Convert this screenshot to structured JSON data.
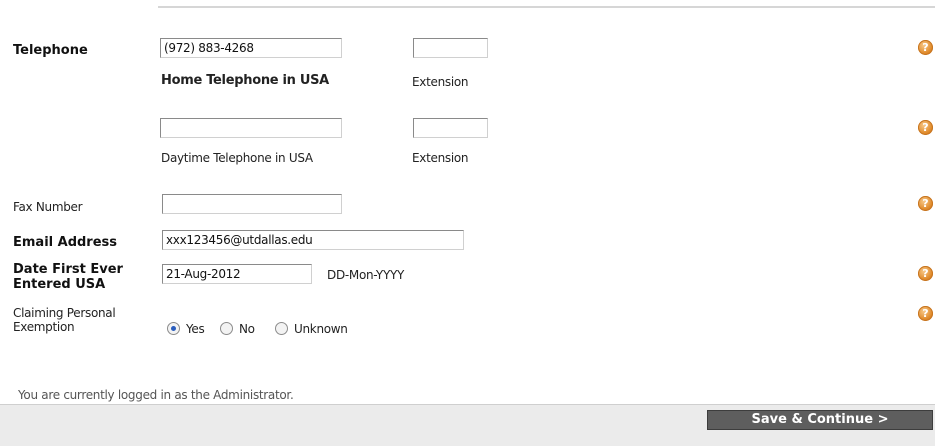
{
  "form": {
    "telephone": {
      "label": "Telephone",
      "home": {
        "value": "(972) 883-4268",
        "caption": "Home Telephone in USA",
        "ext_caption": "Extension",
        "ext_value": ""
      },
      "daytime": {
        "value": "",
        "caption": "Daytime Telephone in USA",
        "ext_caption": "Extension",
        "ext_value": ""
      }
    },
    "fax": {
      "label": "Fax Number",
      "value": ""
    },
    "email": {
      "label": "Email Address",
      "value": "xxx123456@utdallas.edu"
    },
    "date_entered": {
      "label": "Date First Ever Entered USA",
      "value": "21-Aug-2012",
      "format_hint": "DD-Mon-YYYY"
    },
    "exemption": {
      "label": "Claiming Personal Exemption",
      "options": [
        "Yes",
        "No",
        "Unknown"
      ],
      "selected": "Yes"
    }
  },
  "help_icon": {
    "symbol": "?",
    "color": "#e08a2a",
    "icon": "help-icon"
  },
  "footer": {
    "login_text": "You are currently logged in as the Administrator.",
    "save_button": "Save & Continue >"
  }
}
